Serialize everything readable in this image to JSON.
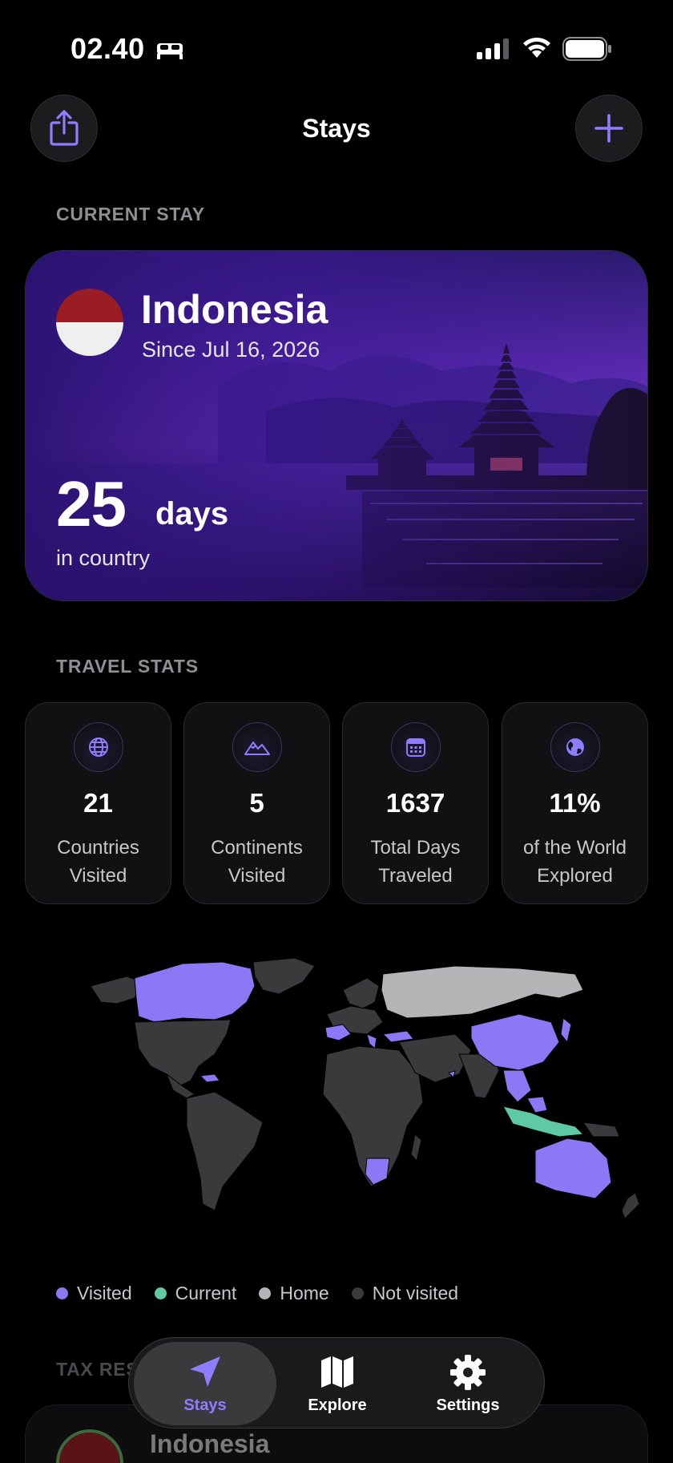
{
  "status_bar": {
    "time": "02.40"
  },
  "header": {
    "title": "Stays"
  },
  "current_stay": {
    "section_label": "CURRENT STAY",
    "country": "Indonesia",
    "since": "Since Jul 16, 2026",
    "days": "25",
    "days_unit": "days",
    "days_caption": "in country"
  },
  "travel_stats": {
    "section_label": "TRAVEL STATS",
    "items": [
      {
        "icon": "globe-icon",
        "value": "21",
        "label": "Countries Visited"
      },
      {
        "icon": "mountains-icon",
        "value": "5",
        "label": "Continents Visited"
      },
      {
        "icon": "calendar-icon",
        "value": "1637",
        "label": "Total Days Traveled"
      },
      {
        "icon": "earth-icon",
        "value": "11%",
        "label": "of the World Explored"
      }
    ]
  },
  "map_legend": [
    {
      "label": "Visited",
      "color": "#8a78f5"
    },
    {
      "label": "Current",
      "color": "#5ec9a3"
    },
    {
      "label": "Home",
      "color": "#b5b5b8"
    },
    {
      "label": "Not visited",
      "color": "#3a3a3c"
    }
  ],
  "tax_residency": {
    "section_label": "TAX RESIDENCY",
    "country": "Indonesia"
  },
  "tab_bar": {
    "tabs": [
      {
        "label": "Stays",
        "icon": "location-arrow-icon",
        "active": true
      },
      {
        "label": "Explore",
        "icon": "map-icon",
        "active": false
      },
      {
        "label": "Settings",
        "icon": "gear-icon",
        "active": false
      }
    ]
  },
  "colors": {
    "accent": "#8e7dff",
    "background": "#000000",
    "card": "#111113"
  }
}
